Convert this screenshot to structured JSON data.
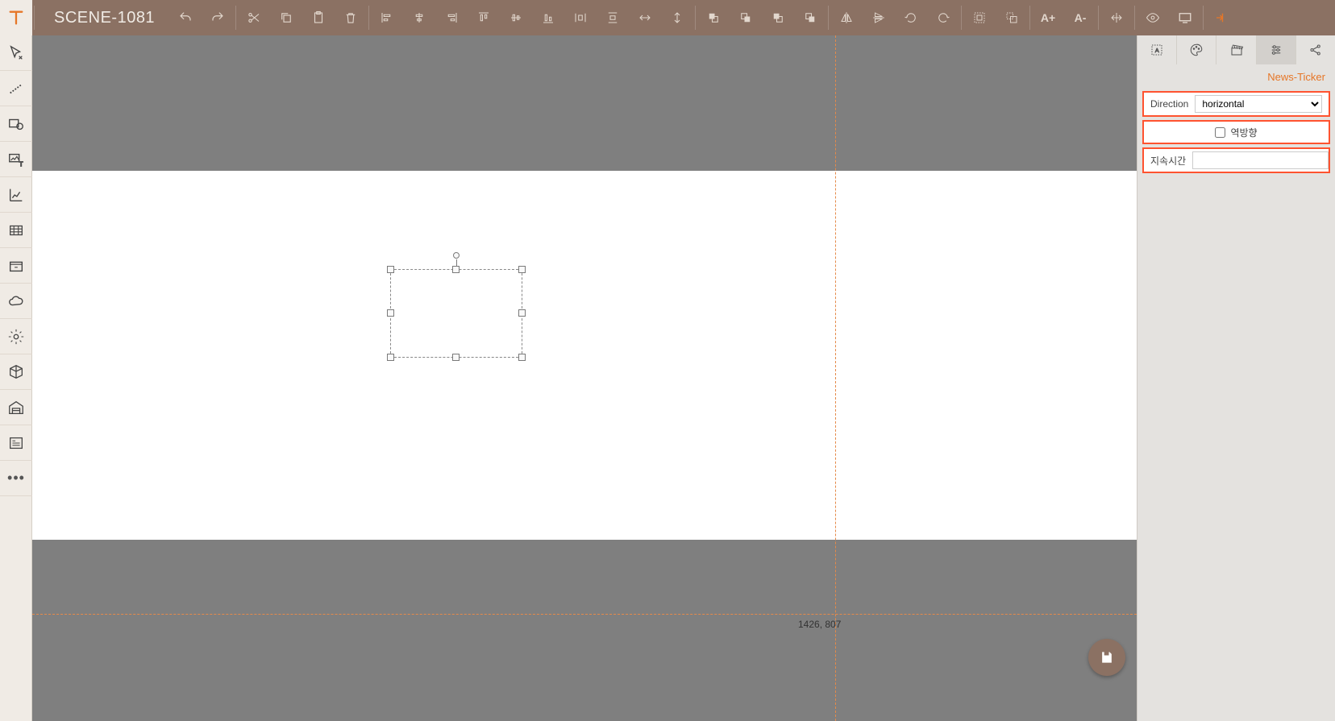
{
  "header": {
    "title": "SCENE-1081",
    "font_plus": "A+",
    "font_minus": "A-"
  },
  "left_tools": [
    {
      "name": "select-tool"
    },
    {
      "name": "line-tool"
    },
    {
      "name": "shape-tool"
    },
    {
      "name": "image-text-tool"
    },
    {
      "name": "chart-tool"
    },
    {
      "name": "table-tool"
    },
    {
      "name": "archive-tool"
    },
    {
      "name": "cloud-tool"
    },
    {
      "name": "gear-cycle-tool"
    },
    {
      "name": "3d-object-tool"
    },
    {
      "name": "warehouse-tool"
    },
    {
      "name": "form-tool"
    },
    {
      "name": "more-tool"
    }
  ],
  "coords": "1426, 807",
  "inspector": {
    "tabs": [
      {
        "name": "text-style",
        "active": false
      },
      {
        "name": "palette",
        "active": false
      },
      {
        "name": "clapper",
        "active": false
      },
      {
        "name": "sliders",
        "active": true
      },
      {
        "name": "share",
        "active": false
      }
    ],
    "panel_title": "News-Ticker",
    "rows": {
      "direction_label": "Direction",
      "direction_value": "horizontal",
      "reverse_label": "역방향",
      "reverse_checked": false,
      "duration_label": "지속시간",
      "duration_value": ""
    }
  }
}
